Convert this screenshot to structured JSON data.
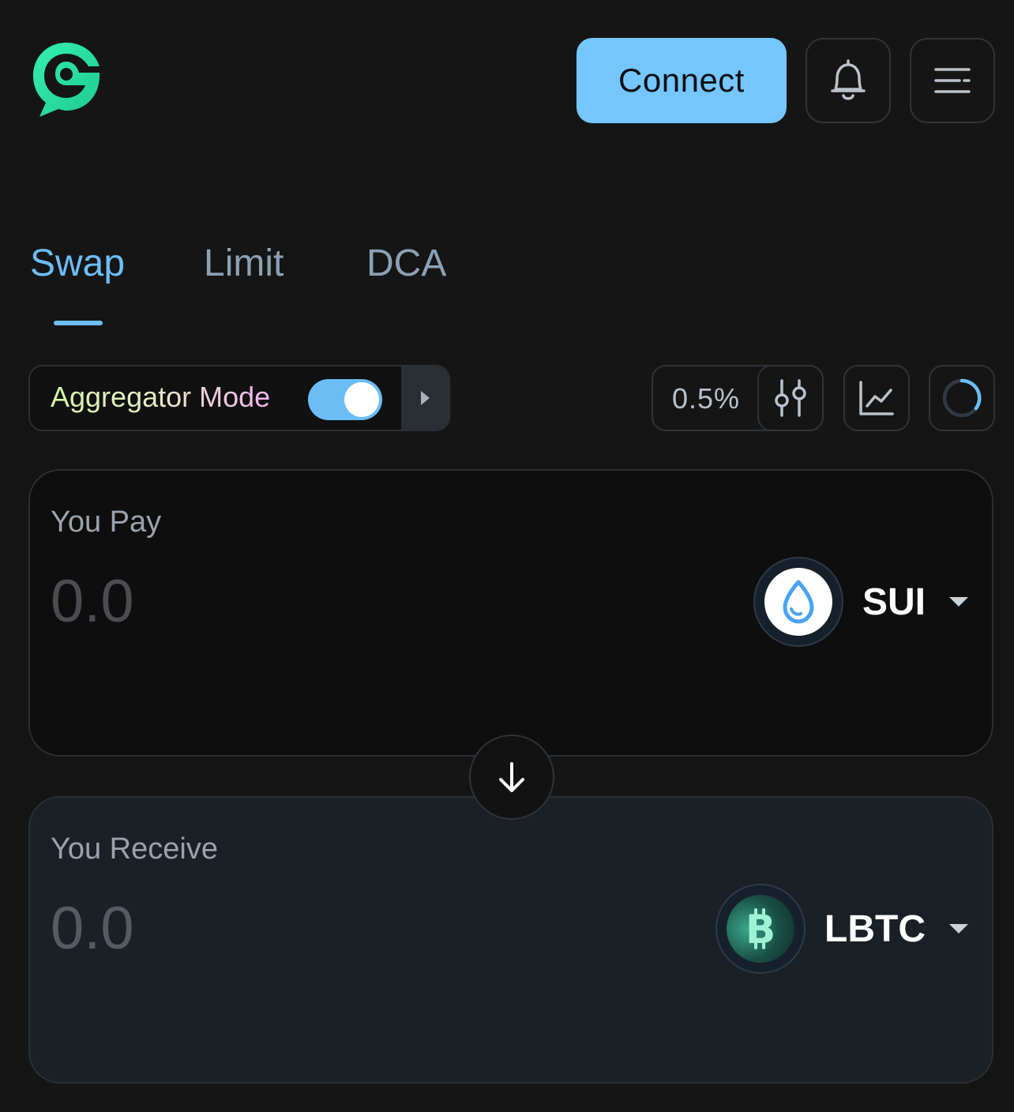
{
  "header": {
    "logo_icon": "brand-bubble-logo",
    "connect_label": "Connect",
    "bell_icon": "bell-icon",
    "menu_icon": "menu-icon"
  },
  "tabs": [
    {
      "label": "Swap",
      "active": true
    },
    {
      "label": "Limit",
      "active": false
    },
    {
      "label": "DCA",
      "active": false
    }
  ],
  "controls": {
    "aggregator_label": "Aggregator Mode",
    "aggregator_enabled": true,
    "slippage": "0.5%",
    "settings_icon": "sliders-icon",
    "chart_icon": "chart-icon",
    "refresh_icon": "refresh-spinner-icon"
  },
  "pay": {
    "label": "You Pay",
    "amount": "0.0",
    "token_symbol": "SUI",
    "token_icon": "sui-drop-icon"
  },
  "receive": {
    "label": "You Receive",
    "amount": "0.0",
    "token_symbol": "LBTC",
    "token_icon": "bitcoin-icon"
  },
  "colors": {
    "accent": "#6dbdf6",
    "connect_bg": "#75c6ff",
    "background": "#151515",
    "brand_green": "#2fe3a6"
  }
}
